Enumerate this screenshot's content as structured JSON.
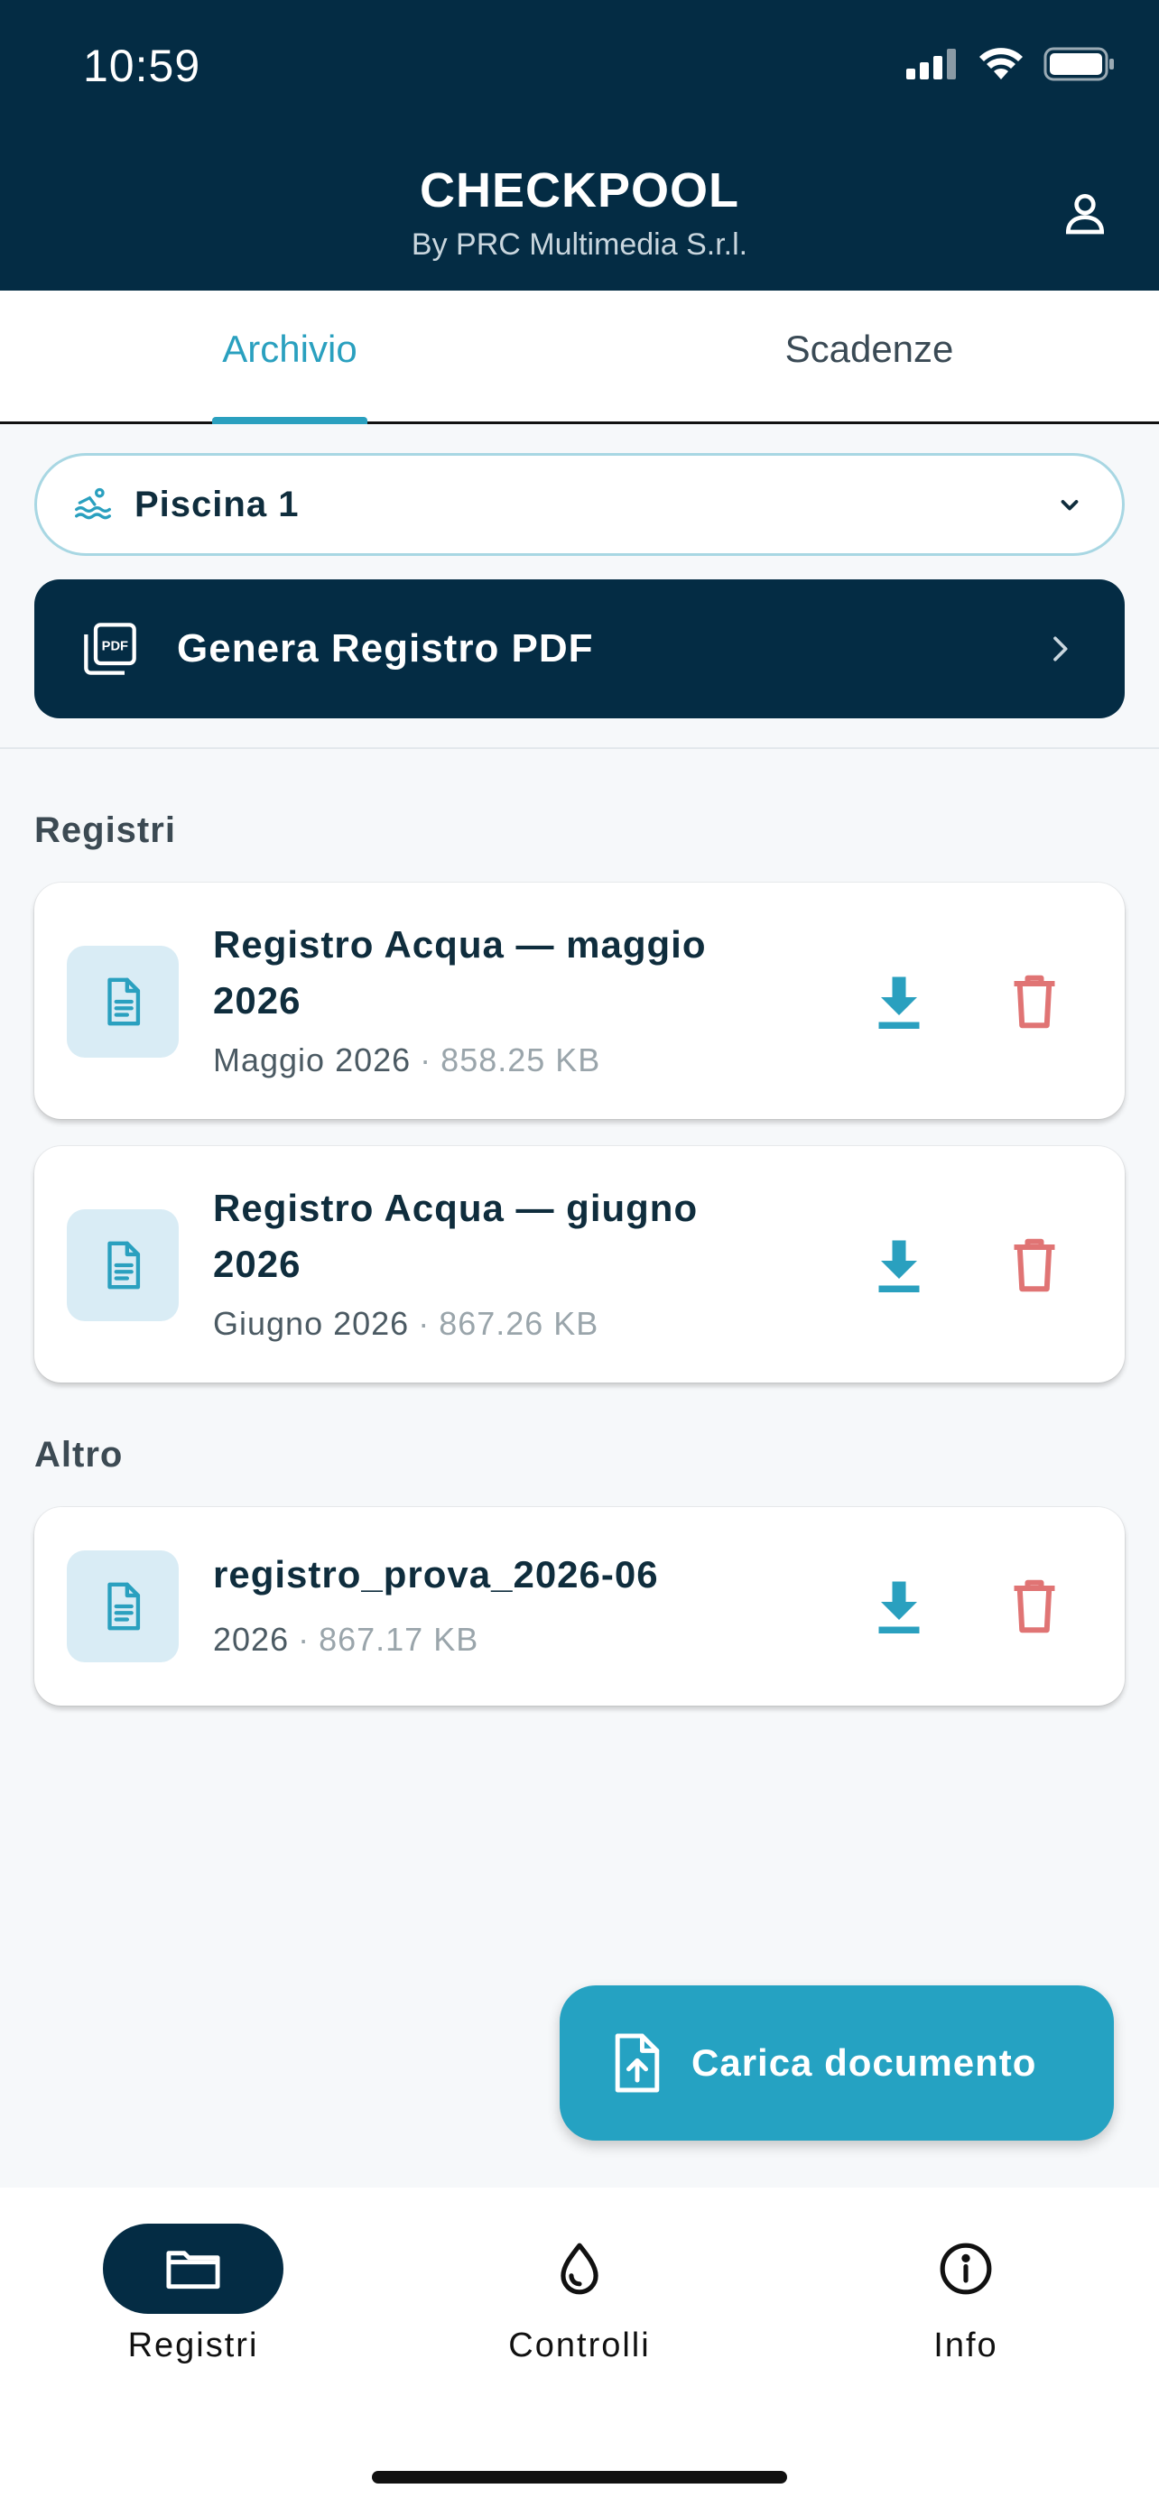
{
  "status_bar": {
    "time": "10:59"
  },
  "header": {
    "title": "CHECKPOOL",
    "subtitle": "By PRC Multimedia S.r.l."
  },
  "tabs": [
    {
      "label": "Archivio",
      "active": true
    },
    {
      "label": "Scadenze",
      "active": false
    }
  ],
  "pool_selector": {
    "value": "Piscina 1"
  },
  "generate_button": {
    "label": "Genera Registro PDF"
  },
  "sections": {
    "registri": {
      "title": "Registri",
      "items": [
        {
          "title": "Registro Acqua — maggio 2026",
          "period": "Maggio 2026",
          "size": "858.25 KB"
        },
        {
          "title": "Registro Acqua — giugno 2026",
          "period": "Giugno 2026",
          "size": "867.26 KB"
        }
      ]
    },
    "altro": {
      "title": "Altro",
      "items": [
        {
          "title": "registro_prova_2026-06",
          "period": "2026",
          "size": "867.17 KB"
        }
      ]
    }
  },
  "fab": {
    "label": "Carica documento"
  },
  "bottom_nav": [
    {
      "label": "Registri",
      "icon": "folder-icon",
      "active": true
    },
    {
      "label": "Controlli",
      "icon": "water-drop-icon",
      "active": false
    },
    {
      "label": "Info",
      "icon": "info-icon",
      "active": false
    }
  ],
  "colors": {
    "header_bg": "#042c44",
    "accent": "#2aa0bf",
    "delete": "#e07474",
    "fab_bg": "#25a2c2"
  }
}
